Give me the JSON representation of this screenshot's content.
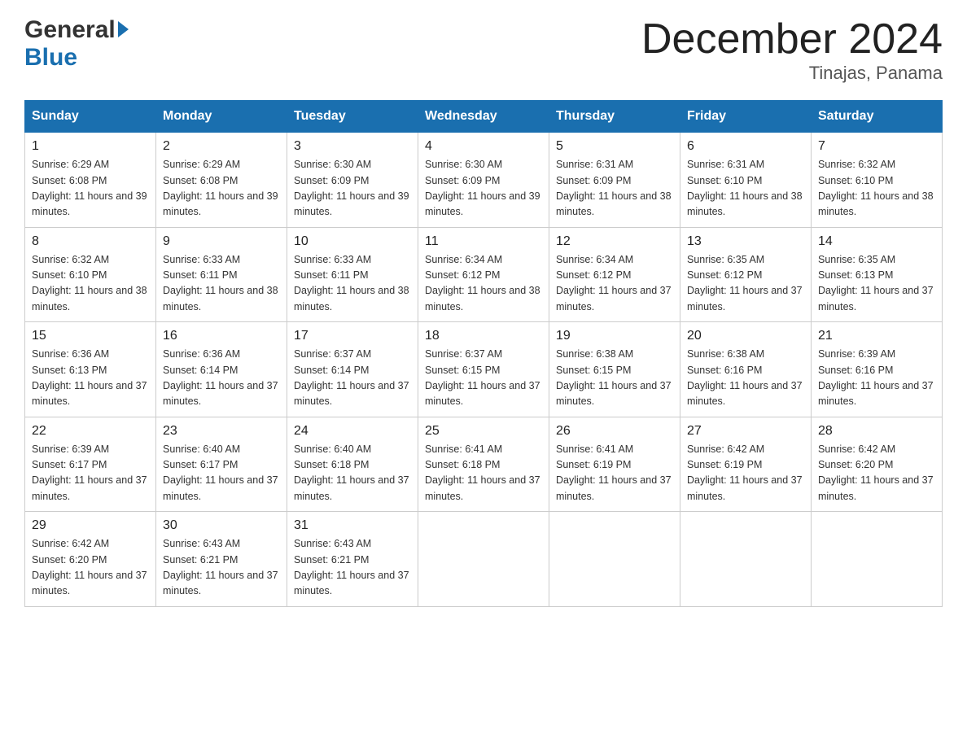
{
  "header": {
    "logo_general": "General",
    "logo_blue": "Blue",
    "month_title": "December 2024",
    "location": "Tinajas, Panama"
  },
  "days_of_week": [
    "Sunday",
    "Monday",
    "Tuesday",
    "Wednesday",
    "Thursday",
    "Friday",
    "Saturday"
  ],
  "weeks": [
    [
      {
        "num": "1",
        "sunrise": "6:29 AM",
        "sunset": "6:08 PM",
        "daylight": "11 hours and 39 minutes."
      },
      {
        "num": "2",
        "sunrise": "6:29 AM",
        "sunset": "6:08 PM",
        "daylight": "11 hours and 39 minutes."
      },
      {
        "num": "3",
        "sunrise": "6:30 AM",
        "sunset": "6:09 PM",
        "daylight": "11 hours and 39 minutes."
      },
      {
        "num": "4",
        "sunrise": "6:30 AM",
        "sunset": "6:09 PM",
        "daylight": "11 hours and 39 minutes."
      },
      {
        "num": "5",
        "sunrise": "6:31 AM",
        "sunset": "6:09 PM",
        "daylight": "11 hours and 38 minutes."
      },
      {
        "num": "6",
        "sunrise": "6:31 AM",
        "sunset": "6:10 PM",
        "daylight": "11 hours and 38 minutes."
      },
      {
        "num": "7",
        "sunrise": "6:32 AM",
        "sunset": "6:10 PM",
        "daylight": "11 hours and 38 minutes."
      }
    ],
    [
      {
        "num": "8",
        "sunrise": "6:32 AM",
        "sunset": "6:10 PM",
        "daylight": "11 hours and 38 minutes."
      },
      {
        "num": "9",
        "sunrise": "6:33 AM",
        "sunset": "6:11 PM",
        "daylight": "11 hours and 38 minutes."
      },
      {
        "num": "10",
        "sunrise": "6:33 AM",
        "sunset": "6:11 PM",
        "daylight": "11 hours and 38 minutes."
      },
      {
        "num": "11",
        "sunrise": "6:34 AM",
        "sunset": "6:12 PM",
        "daylight": "11 hours and 38 minutes."
      },
      {
        "num": "12",
        "sunrise": "6:34 AM",
        "sunset": "6:12 PM",
        "daylight": "11 hours and 37 minutes."
      },
      {
        "num": "13",
        "sunrise": "6:35 AM",
        "sunset": "6:12 PM",
        "daylight": "11 hours and 37 minutes."
      },
      {
        "num": "14",
        "sunrise": "6:35 AM",
        "sunset": "6:13 PM",
        "daylight": "11 hours and 37 minutes."
      }
    ],
    [
      {
        "num": "15",
        "sunrise": "6:36 AM",
        "sunset": "6:13 PM",
        "daylight": "11 hours and 37 minutes."
      },
      {
        "num": "16",
        "sunrise": "6:36 AM",
        "sunset": "6:14 PM",
        "daylight": "11 hours and 37 minutes."
      },
      {
        "num": "17",
        "sunrise": "6:37 AM",
        "sunset": "6:14 PM",
        "daylight": "11 hours and 37 minutes."
      },
      {
        "num": "18",
        "sunrise": "6:37 AM",
        "sunset": "6:15 PM",
        "daylight": "11 hours and 37 minutes."
      },
      {
        "num": "19",
        "sunrise": "6:38 AM",
        "sunset": "6:15 PM",
        "daylight": "11 hours and 37 minutes."
      },
      {
        "num": "20",
        "sunrise": "6:38 AM",
        "sunset": "6:16 PM",
        "daylight": "11 hours and 37 minutes."
      },
      {
        "num": "21",
        "sunrise": "6:39 AM",
        "sunset": "6:16 PM",
        "daylight": "11 hours and 37 minutes."
      }
    ],
    [
      {
        "num": "22",
        "sunrise": "6:39 AM",
        "sunset": "6:17 PM",
        "daylight": "11 hours and 37 minutes."
      },
      {
        "num": "23",
        "sunrise": "6:40 AM",
        "sunset": "6:17 PM",
        "daylight": "11 hours and 37 minutes."
      },
      {
        "num": "24",
        "sunrise": "6:40 AM",
        "sunset": "6:18 PM",
        "daylight": "11 hours and 37 minutes."
      },
      {
        "num": "25",
        "sunrise": "6:41 AM",
        "sunset": "6:18 PM",
        "daylight": "11 hours and 37 minutes."
      },
      {
        "num": "26",
        "sunrise": "6:41 AM",
        "sunset": "6:19 PM",
        "daylight": "11 hours and 37 minutes."
      },
      {
        "num": "27",
        "sunrise": "6:42 AM",
        "sunset": "6:19 PM",
        "daylight": "11 hours and 37 minutes."
      },
      {
        "num": "28",
        "sunrise": "6:42 AM",
        "sunset": "6:20 PM",
        "daylight": "11 hours and 37 minutes."
      }
    ],
    [
      {
        "num": "29",
        "sunrise": "6:42 AM",
        "sunset": "6:20 PM",
        "daylight": "11 hours and 37 minutes."
      },
      {
        "num": "30",
        "sunrise": "6:43 AM",
        "sunset": "6:21 PM",
        "daylight": "11 hours and 37 minutes."
      },
      {
        "num": "31",
        "sunrise": "6:43 AM",
        "sunset": "6:21 PM",
        "daylight": "11 hours and 37 minutes."
      },
      null,
      null,
      null,
      null
    ]
  ]
}
